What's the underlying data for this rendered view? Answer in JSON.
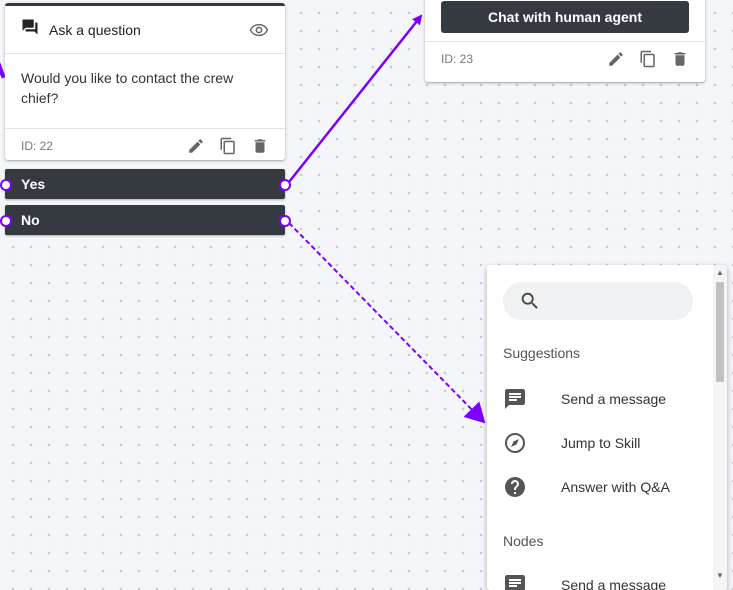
{
  "card_question": {
    "title": "Ask a question",
    "text": "Would you like to contact the crew chief?",
    "id_label": "ID: 22",
    "answers": [
      "Yes",
      "No"
    ]
  },
  "card_action": {
    "button_label": "Chat with human agent",
    "id_label": "ID: 23"
  },
  "picker": {
    "search_placeholder": "",
    "suggestions_heading": "Suggestions",
    "suggestions": [
      {
        "label": "Send a message",
        "icon": "message-icon"
      },
      {
        "label": "Jump to Skill",
        "icon": "compass-icon"
      },
      {
        "label": "Answer with Q&A",
        "icon": "help-icon"
      }
    ],
    "nodes_heading": "Nodes",
    "nodes": [
      {
        "label": "Send a message",
        "icon": "message-icon"
      }
    ]
  },
  "colors": {
    "accent": "#7b00ff",
    "node_dark": "#343a40",
    "canvas": "#f4f6f9"
  }
}
